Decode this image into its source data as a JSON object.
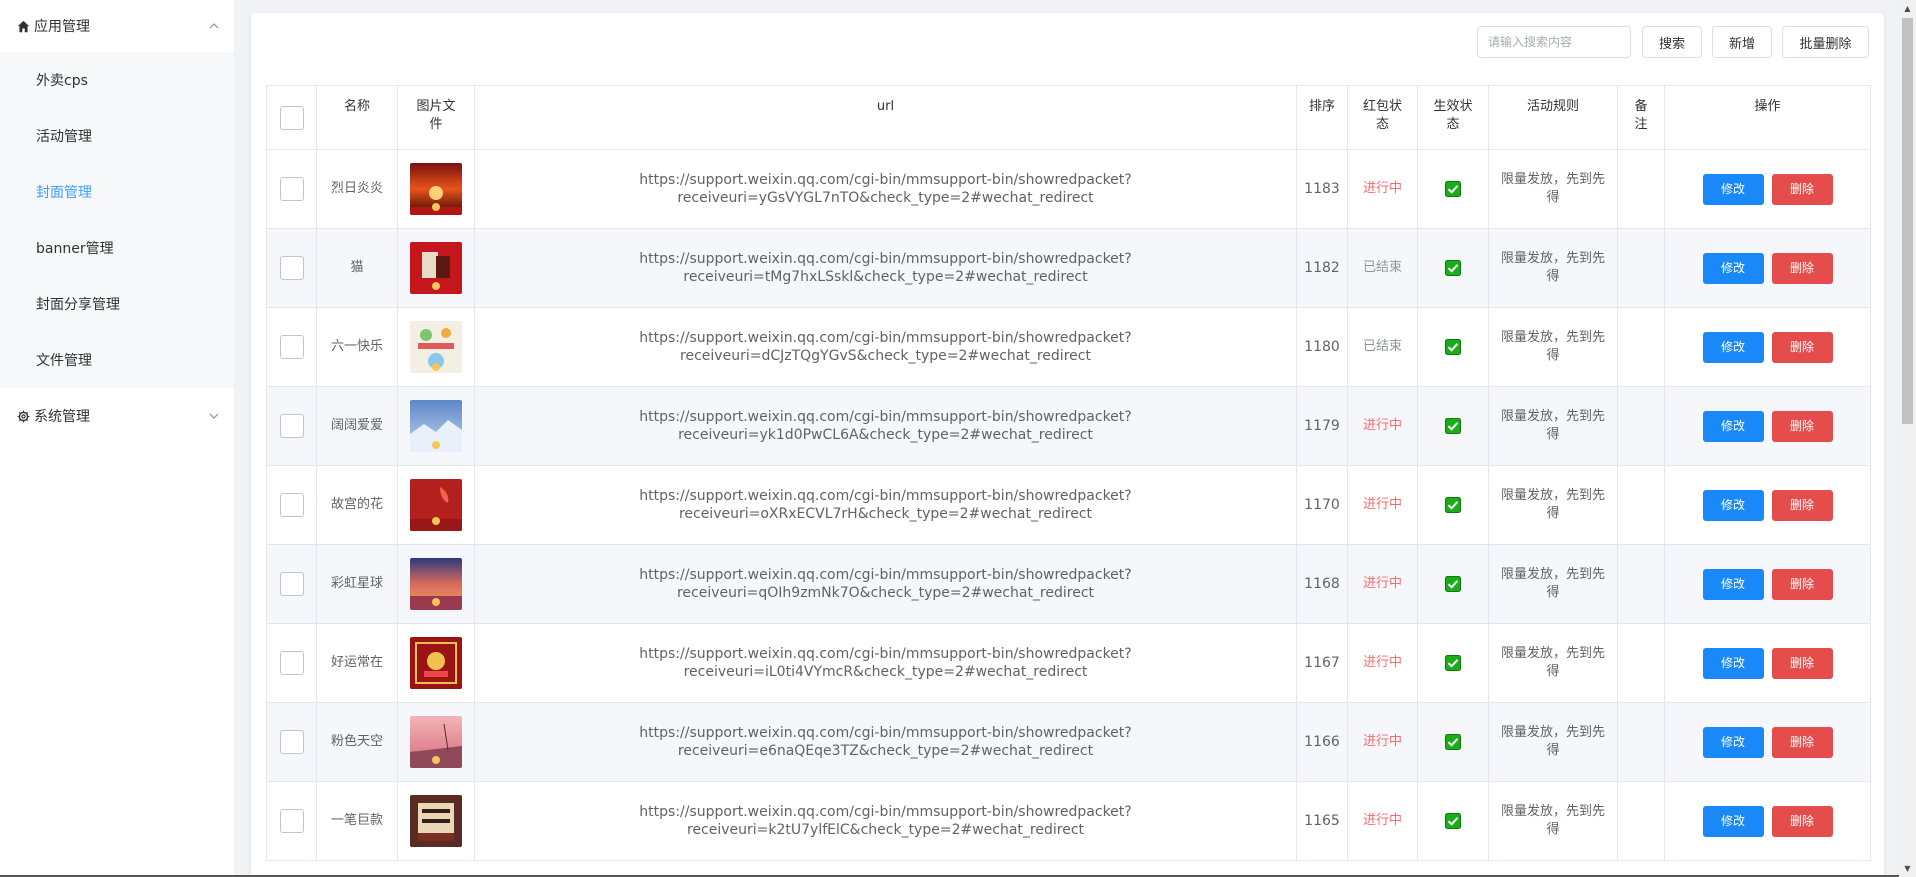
{
  "sidebar": {
    "group1": {
      "label": "应用管理",
      "icon": "home-icon"
    },
    "items": [
      {
        "label": "外卖cps",
        "active": false
      },
      {
        "label": "活动管理",
        "active": false
      },
      {
        "label": "封面管理",
        "active": true
      },
      {
        "label": "banner管理",
        "active": false
      },
      {
        "label": "封面分享管理",
        "active": false
      },
      {
        "label": "文件管理",
        "active": false
      }
    ],
    "group2": {
      "label": "系统管理",
      "icon": "gear-icon"
    }
  },
  "toolbar": {
    "search_placeholder": "请输入搜索内容",
    "search_label": "搜索",
    "add_label": "新增",
    "batch_delete_label": "批量删除"
  },
  "table": {
    "headers": {
      "name": "名称",
      "image": "图片文件",
      "url": "url",
      "sort": "排序",
      "status": "红包状态",
      "effective": "生效状态",
      "rule": "活动规则",
      "remark": "备注",
      "action": "操作"
    },
    "edit_label": "修改",
    "delete_label": "删除",
    "rows": [
      {
        "name": "烈日炎炎",
        "url1": "https://support.weixin.qq.com/cgi-bin/mmsupport-bin/showredpacket?",
        "url2": "receiveuri=yGsVYGL7nTO&check_type=2#wechat_redirect",
        "sort": "1183",
        "status": "进行中",
        "rule": "限量发放，先到先得"
      },
      {
        "name": "猫",
        "url1": "https://support.weixin.qq.com/cgi-bin/mmsupport-bin/showredpacket?",
        "url2": "receiveuri=tMg7hxLSskl&check_type=2#wechat_redirect",
        "sort": "1182",
        "status": "已结束",
        "rule": "限量发放，先到先得"
      },
      {
        "name": "六一快乐",
        "url1": "https://support.weixin.qq.com/cgi-bin/mmsupport-bin/showredpacket?",
        "url2": "receiveuri=dCJzTQgYGvS&check_type=2#wechat_redirect",
        "sort": "1180",
        "status": "已结束",
        "rule": "限量发放，先到先得"
      },
      {
        "name": "阔阔爱爱",
        "url1": "https://support.weixin.qq.com/cgi-bin/mmsupport-bin/showredpacket?",
        "url2": "receiveuri=yk1d0PwCL6A&check_type=2#wechat_redirect",
        "sort": "1179",
        "status": "进行中",
        "rule": "限量发放，先到先得"
      },
      {
        "name": "故宫的花",
        "url1": "https://support.weixin.qq.com/cgi-bin/mmsupport-bin/showredpacket?",
        "url2": "receiveuri=oXRxECVL7rH&check_type=2#wechat_redirect",
        "sort": "1170",
        "status": "进行中",
        "rule": "限量发放，先到先得"
      },
      {
        "name": "彩虹星球",
        "url1": "https://support.weixin.qq.com/cgi-bin/mmsupport-bin/showredpacket?",
        "url2": "receiveuri=qOIh9zmNk7O&check_type=2#wechat_redirect",
        "sort": "1168",
        "status": "进行中",
        "rule": "限量发放，先到先得"
      },
      {
        "name": "好运常在",
        "url1": "https://support.weixin.qq.com/cgi-bin/mmsupport-bin/showredpacket?",
        "url2": "receiveuri=iL0ti4VYmcR&check_type=2#wechat_redirect",
        "sort": "1167",
        "status": "进行中",
        "rule": "限量发放，先到先得"
      },
      {
        "name": "粉色天空",
        "url1": "https://support.weixin.qq.com/cgi-bin/mmsupport-bin/showredpacket?",
        "url2": "receiveuri=e6naQEqe3TZ&check_type=2#wechat_redirect",
        "sort": "1166",
        "status": "进行中",
        "rule": "限量发放，先到先得"
      },
      {
        "name": "一笔巨款",
        "url1": "https://support.weixin.qq.com/cgi-bin/mmsupport-bin/showredpacket?",
        "url2": "receiveuri=k2tU7ylfElC&check_type=2#wechat_redirect",
        "sort": "1165",
        "status": "进行中",
        "rule": "限量发放，先到先得"
      }
    ]
  },
  "colors": {
    "accent": "#409eff",
    "edit_button": "#1989fa",
    "delete_button": "#e54d4d",
    "status_active": "#f56c6c",
    "status_ended": "#909399",
    "effective_check": "#1aad19"
  }
}
